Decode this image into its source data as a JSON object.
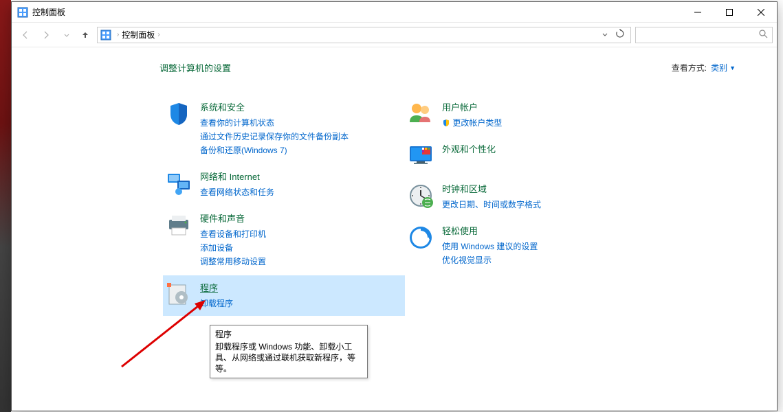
{
  "window": {
    "title": "控制面板"
  },
  "nav": {
    "breadcrumb_root": "控制面板",
    "search_placeholder": ""
  },
  "header": {
    "title": "调整计算机的设置",
    "view_label": "查看方式:",
    "view_value": "类别"
  },
  "left_column": [
    {
      "title": "系统和安全",
      "links": [
        "查看你的计算机状态",
        "通过文件历史记录保存你的文件备份副本",
        "备份和还原(Windows 7)"
      ]
    },
    {
      "title": "网络和 Internet",
      "links": [
        "查看网络状态和任务"
      ]
    },
    {
      "title": "硬件和声音",
      "links": [
        "查看设备和打印机",
        "添加设备",
        "调整常用移动设置"
      ]
    },
    {
      "title": "程序",
      "links": [
        "卸载程序"
      ]
    }
  ],
  "right_column": [
    {
      "title": "用户帐户",
      "links": [
        "更改帐户类型"
      ],
      "has_badge": true
    },
    {
      "title": "外观和个性化",
      "links": []
    },
    {
      "title": "时钟和区域",
      "links": [
        "更改日期、时间或数字格式"
      ]
    },
    {
      "title": "轻松使用",
      "links": [
        "使用 Windows 建议的设置",
        "优化视觉显示"
      ]
    }
  ],
  "tooltip": {
    "title": "程序",
    "body": "卸载程序或 Windows 功能、卸载小工具、从网络或通过联机获取新程序，等等。"
  }
}
